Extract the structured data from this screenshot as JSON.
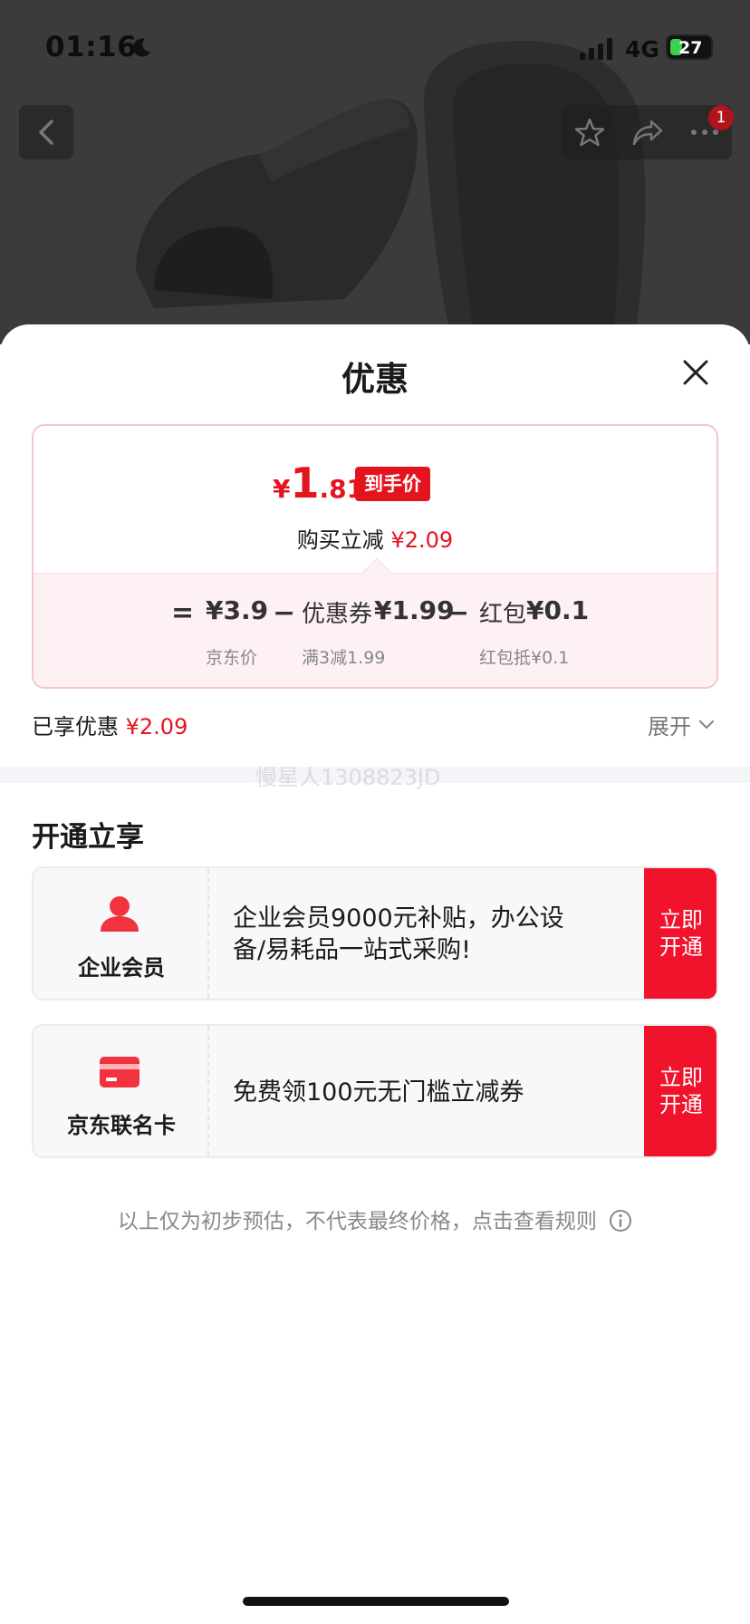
{
  "status_bar": {
    "time": "01:16",
    "network": "4G",
    "battery": "27"
  },
  "nav": {
    "badge_count": "1",
    "icons": [
      "back-icon",
      "star-icon",
      "share-icon",
      "more-icon"
    ]
  },
  "sheet": {
    "title": "优惠",
    "price_card": {
      "final_symbol": "¥",
      "final_int": "1",
      "final_dec": ".81",
      "final_tag": "到手价",
      "reduce_label": "购买立减",
      "reduce_value": "¥2.09",
      "formula": {
        "eq": "=",
        "jd_price": "¥3.9",
        "jd_price_label": "京东价",
        "minus1": "−",
        "coupon_label": "优惠券",
        "coupon_value": "¥1.99",
        "coupon_sub": "满3减1.99",
        "minus2": "−",
        "redpack_label": "红包",
        "redpack_value": "¥0.1",
        "redpack_sub": "红包抵¥0.1"
      }
    },
    "enjoyed_label": "已享优惠",
    "enjoyed_value": "¥2.09",
    "expand_label": "展开",
    "watermark": "慢星人1308823JD",
    "section_title": "开通立享",
    "benefits": [
      {
        "name": "企业会员",
        "icon": "user-icon",
        "desc_line1": "企业会员9000元补贴，办公设",
        "desc_line2": "备/易耗品一站式采购!",
        "button_line1": "立即",
        "button_line2": "开通"
      },
      {
        "name": "京东联名卡",
        "icon": "card-icon",
        "desc_line1": "免费领100元无门槛立减券",
        "button_line1": "立即",
        "button_line2": "开通"
      }
    ],
    "disclaimer": "以上仅为初步预估，不代表最终价格，点击查看规则"
  },
  "colors": {
    "accent_red": "#e4141e",
    "button_red": "#f1132c",
    "card_border": "#f5c5cc"
  }
}
